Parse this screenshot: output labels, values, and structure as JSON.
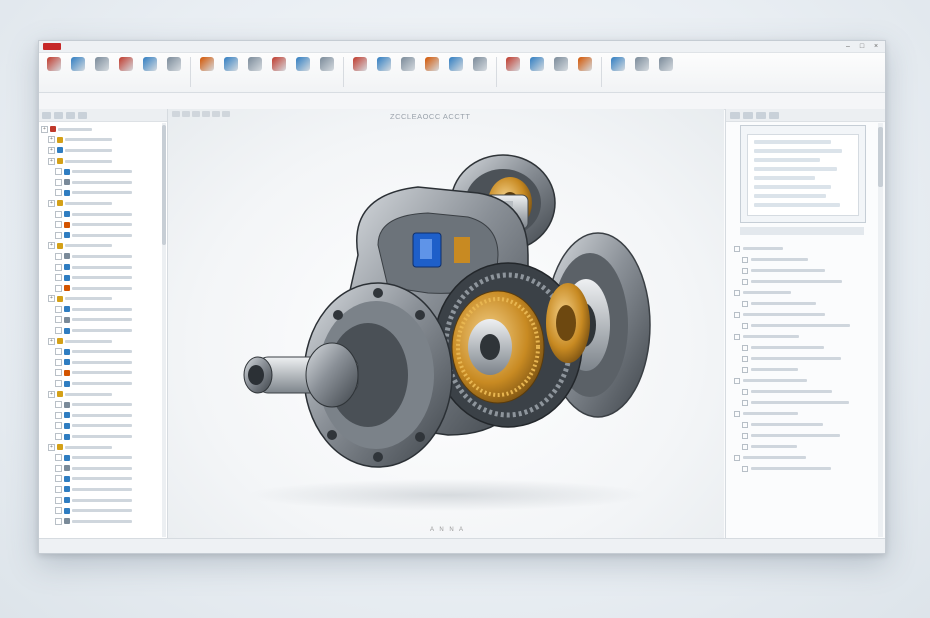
{
  "window": {
    "title": "",
    "menu": [
      "",
      "",
      "",
      "",
      "",
      ""
    ]
  },
  "ribbon": {
    "buttons": [
      {
        "icon": "extrude-icon",
        "color": "#c0392b"
      },
      {
        "icon": "revolve-icon",
        "color": "#2f7dc1"
      },
      {
        "icon": "sweep-icon",
        "color": "#7a8a99"
      },
      {
        "icon": "loft-icon",
        "color": "#c0392b"
      },
      {
        "icon": "hole-icon",
        "color": "#2f7dc1"
      },
      {
        "icon": "fillet-icon",
        "color": "#7a8a99"
      },
      {
        "icon": "chamfer-icon",
        "color": "#d35400"
      },
      {
        "icon": "shell-icon",
        "color": "#2f7dc1"
      },
      {
        "icon": "pattern-icon",
        "color": "#7a8a99"
      },
      {
        "icon": "mirror-icon",
        "color": "#c0392b"
      },
      {
        "icon": "rib-icon",
        "color": "#2f7dc1"
      },
      {
        "icon": "draft-icon",
        "color": "#7a8a99"
      },
      {
        "icon": "mate-icon",
        "color": "#c0392b"
      },
      {
        "icon": "component-icon",
        "color": "#2f7dc1"
      },
      {
        "icon": "move-icon",
        "color": "#7a8a99"
      },
      {
        "icon": "rotate-icon",
        "color": "#d35400"
      },
      {
        "icon": "measure-icon",
        "color": "#2f7dc1"
      },
      {
        "icon": "section-icon",
        "color": "#7a8a99"
      },
      {
        "icon": "explode-icon",
        "color": "#c0392b"
      },
      {
        "icon": "render-icon",
        "color": "#2f7dc1"
      },
      {
        "icon": "simulate-icon",
        "color": "#7a8a99"
      },
      {
        "icon": "drawing-icon",
        "color": "#d35400"
      },
      {
        "icon": "bom-icon",
        "color": "#2f7dc1"
      },
      {
        "icon": "export-icon",
        "color": "#7a8a99"
      },
      {
        "icon": "options-icon",
        "color": "#7a8a99"
      }
    ]
  },
  "viewport": {
    "title": "ZCCLEAOCC ACCTT",
    "bottom_text": "A N N A"
  },
  "colors": {
    "accent": "#c62828",
    "blue_part": "#1e5fc9",
    "brass": "#d79a2b"
  },
  "left_tree": {
    "rows": [
      {
        "indent": 0,
        "icon": "assembly-icon",
        "color": "#c0392b"
      },
      {
        "indent": 1,
        "icon": "folder-icon",
        "color": "#d4a017"
      },
      {
        "indent": 1,
        "icon": "part-icon",
        "color": "#2f7dc1"
      },
      {
        "indent": 1,
        "icon": "folder-icon",
        "color": "#d4a017"
      },
      {
        "indent": 2,
        "icon": "part-icon",
        "color": "#2f7dc1"
      },
      {
        "indent": 2,
        "icon": "part-icon",
        "color": "#7a8a99"
      },
      {
        "indent": 2,
        "icon": "part-icon",
        "color": "#2f7dc1"
      },
      {
        "indent": 1,
        "icon": "folder-icon",
        "color": "#d4a017"
      },
      {
        "indent": 2,
        "icon": "part-icon",
        "color": "#2f7dc1"
      },
      {
        "indent": 2,
        "icon": "part-icon",
        "color": "#d35400"
      },
      {
        "indent": 2,
        "icon": "part-icon",
        "color": "#2f7dc1"
      },
      {
        "indent": 1,
        "icon": "folder-icon",
        "color": "#d4a017"
      },
      {
        "indent": 2,
        "icon": "part-icon",
        "color": "#7a8a99"
      },
      {
        "indent": 2,
        "icon": "part-icon",
        "color": "#2f7dc1"
      },
      {
        "indent": 2,
        "icon": "part-icon",
        "color": "#2f7dc1"
      },
      {
        "indent": 2,
        "icon": "part-icon",
        "color": "#d35400"
      },
      {
        "indent": 1,
        "icon": "folder-icon",
        "color": "#d4a017"
      },
      {
        "indent": 2,
        "icon": "part-icon",
        "color": "#2f7dc1"
      },
      {
        "indent": 2,
        "icon": "part-icon",
        "color": "#7a8a99"
      },
      {
        "indent": 2,
        "icon": "part-icon",
        "color": "#2f7dc1"
      },
      {
        "indent": 1,
        "icon": "folder-icon",
        "color": "#d4a017"
      },
      {
        "indent": 2,
        "icon": "part-icon",
        "color": "#2f7dc1"
      },
      {
        "indent": 2,
        "icon": "part-icon",
        "color": "#2f7dc1"
      },
      {
        "indent": 2,
        "icon": "part-icon",
        "color": "#d35400"
      },
      {
        "indent": 2,
        "icon": "part-icon",
        "color": "#2f7dc1"
      },
      {
        "indent": 1,
        "icon": "folder-icon",
        "color": "#d4a017"
      },
      {
        "indent": 2,
        "icon": "part-icon",
        "color": "#7a8a99"
      },
      {
        "indent": 2,
        "icon": "part-icon",
        "color": "#2f7dc1"
      },
      {
        "indent": 2,
        "icon": "part-icon",
        "color": "#2f7dc1"
      },
      {
        "indent": 2,
        "icon": "part-icon",
        "color": "#2f7dc1"
      },
      {
        "indent": 1,
        "icon": "folder-icon",
        "color": "#d4a017"
      },
      {
        "indent": 2,
        "icon": "part-icon",
        "color": "#2f7dc1"
      },
      {
        "indent": 2,
        "icon": "part-icon",
        "color": "#7a8a99"
      },
      {
        "indent": 2,
        "icon": "part-icon",
        "color": "#2f7dc1"
      },
      {
        "indent": 2,
        "icon": "part-icon",
        "color": "#2f7dc1"
      },
      {
        "indent": 2,
        "icon": "part-icon",
        "color": "#2f7dc1"
      },
      {
        "indent": 2,
        "icon": "part-icon",
        "color": "#2f7dc1"
      },
      {
        "indent": 2,
        "icon": "part-icon",
        "color": "#7a8a99"
      }
    ]
  },
  "right_panel": {
    "rows": [
      {
        "indent": 0,
        "icon": "property-icon"
      },
      {
        "indent": 1,
        "icon": "property-icon"
      },
      {
        "indent": 1,
        "icon": "property-icon"
      },
      {
        "indent": 1,
        "icon": "property-icon"
      },
      {
        "indent": 0,
        "icon": "property-icon"
      },
      {
        "indent": 1,
        "icon": "property-icon"
      },
      {
        "indent": 0,
        "icon": "property-icon"
      },
      {
        "indent": 1,
        "icon": "property-icon"
      },
      {
        "indent": 0,
        "icon": "property-icon"
      },
      {
        "indent": 1,
        "icon": "property-icon"
      },
      {
        "indent": 1,
        "icon": "property-icon"
      },
      {
        "indent": 1,
        "icon": "property-icon"
      },
      {
        "indent": 0,
        "icon": "property-icon"
      },
      {
        "indent": 1,
        "icon": "property-icon"
      },
      {
        "indent": 1,
        "icon": "property-icon"
      },
      {
        "indent": 0,
        "icon": "property-icon"
      },
      {
        "indent": 1,
        "icon": "property-icon"
      },
      {
        "indent": 1,
        "icon": "property-icon"
      },
      {
        "indent": 1,
        "icon": "property-icon"
      },
      {
        "indent": 0,
        "icon": "property-icon"
      },
      {
        "indent": 1,
        "icon": "property-icon"
      }
    ]
  }
}
